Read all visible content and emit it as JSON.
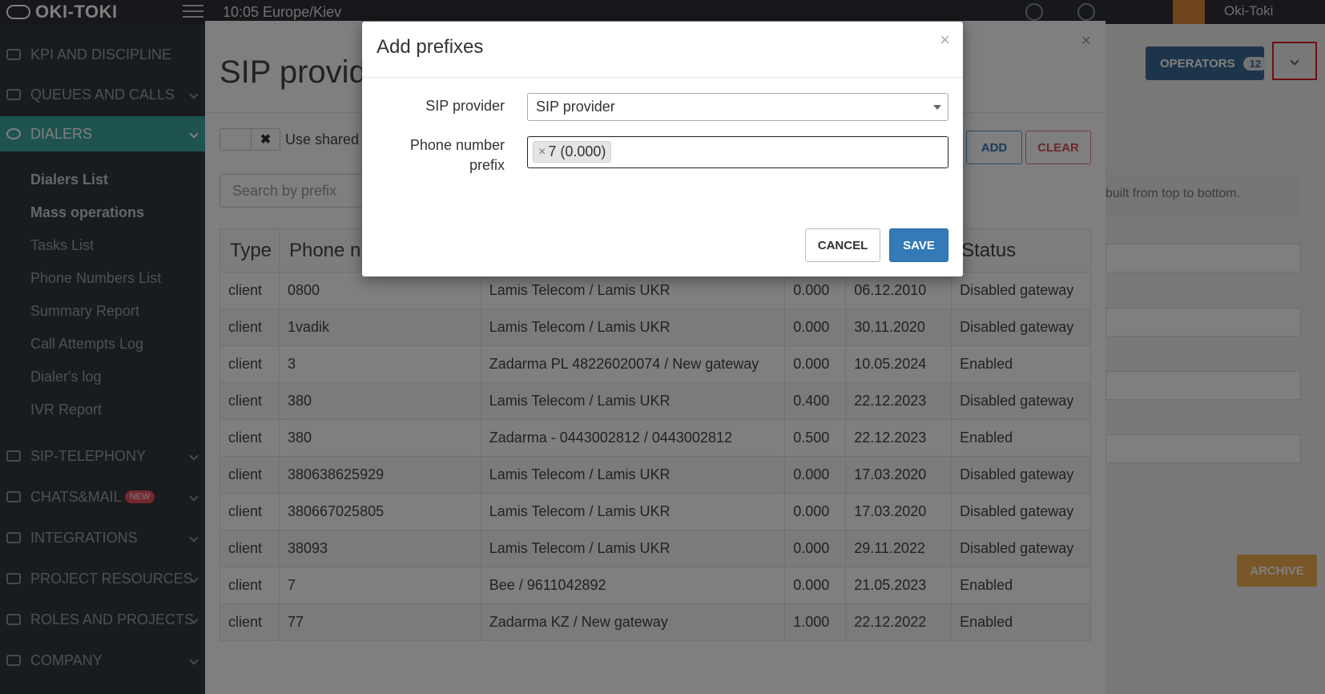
{
  "topbar": {
    "brand": "OKI-TOKI",
    "clock": "10:05  Europe/Kiev",
    "user": "Oki-Toki"
  },
  "sidebar": {
    "items": [
      {
        "label": "KPI AND DISCIPLINE",
        "icon": "check-icon"
      },
      {
        "label": "QUEUES AND CALLS",
        "icon": "list-icon"
      },
      {
        "label": "DIALERS",
        "icon": "clock-icon"
      },
      {
        "label": "SIP-TELEPHONY",
        "icon": "phone-icon"
      },
      {
        "label": "CHATS&MAIL",
        "icon": "chat-icon",
        "badge": "NEW"
      },
      {
        "label": "INTEGRATIONS",
        "icon": "share-icon"
      },
      {
        "label": "PROJECT RESOURCES",
        "icon": "list-icon"
      },
      {
        "label": "ROLES AND PROJECTS",
        "icon": "users-icon"
      },
      {
        "label": "COMPANY",
        "icon": "building-icon"
      }
    ],
    "subitems": [
      "Dialers List",
      "Mass operations",
      "Tasks List",
      "Phone Numbers List",
      "Summary Report",
      "Call Attempts Log",
      "Dialer's log",
      "IVR Report"
    ]
  },
  "right": {
    "operators_label": "OPERATORS",
    "operators_count": "12",
    "hint": "built from top to bottom.",
    "archive_label": "ARCHIVE"
  },
  "panel": {
    "title": "SIP provide",
    "use_shared_label": "Use shared",
    "add_label": "ADD",
    "clear_label": "CLEAR",
    "search_placeholder": "Search by prefix",
    "columns": [
      "Type",
      "Phone n",
      "",
      "",
      "",
      "Status"
    ],
    "rows": [
      {
        "type": "client",
        "phone": "0800",
        "provider": "Lamis Telecom / Lamis UKR",
        "price": "0.000",
        "date": "06.12.2010",
        "status": "Disabled gateway"
      },
      {
        "type": "client",
        "phone": "1vadik",
        "provider": "Lamis Telecom / Lamis UKR",
        "price": "0.000",
        "date": "30.11.2020",
        "status": "Disabled gateway"
      },
      {
        "type": "client",
        "phone": "3",
        "provider": "Zadarma PL 48226020074 / New gateway",
        "price": "0.000",
        "date": "10.05.2024",
        "status": "Enabled"
      },
      {
        "type": "client",
        "phone": "380",
        "provider": "Lamis Telecom / Lamis UKR",
        "price": "0.400",
        "date": "22.12.2023",
        "status": "Disabled gateway"
      },
      {
        "type": "client",
        "phone": "380",
        "provider": "Zadarma - 0443002812 / 0443002812",
        "price": "0.500",
        "date": "22.12.2023",
        "status": "Enabled"
      },
      {
        "type": "client",
        "phone": "380638625929",
        "provider": "Lamis Telecom / Lamis UKR",
        "price": "0.000",
        "date": "17.03.2020",
        "status": "Disabled gateway"
      },
      {
        "type": "client",
        "phone": "380667025805",
        "provider": "Lamis Telecom / Lamis UKR",
        "price": "0.000",
        "date": "17.03.2020",
        "status": "Disabled gateway"
      },
      {
        "type": "client",
        "phone": "38093",
        "provider": "Lamis Telecom / Lamis UKR",
        "price": "0.000",
        "date": "29.11.2022",
        "status": "Disabled gateway"
      },
      {
        "type": "client",
        "phone": "7",
        "provider": "Bee / 9611042892",
        "price": "0.000",
        "date": "21.05.2023",
        "status": "Enabled"
      },
      {
        "type": "client",
        "phone": "77",
        "provider": "Zadarma KZ / New gateway",
        "price": "1.000",
        "date": "22.12.2022",
        "status": "Enabled"
      }
    ]
  },
  "modal": {
    "title": "Add prefixes",
    "close": "×",
    "sip_provider_label": "SIP provider",
    "sip_provider_value": "SIP provider",
    "phone_prefix_label_1": "Phone number",
    "phone_prefix_label_2": "prefix",
    "tag_remove": "×",
    "tag_value": "7 (0.000)",
    "cancel_label": "CANCEL",
    "save_label": "SAVE"
  },
  "colors": {
    "accent": "#337ab7",
    "active_nav": "#3da6a0",
    "danger": "#d9534f",
    "enabled": "#3a9b92",
    "highlight_box": "#e02020"
  }
}
